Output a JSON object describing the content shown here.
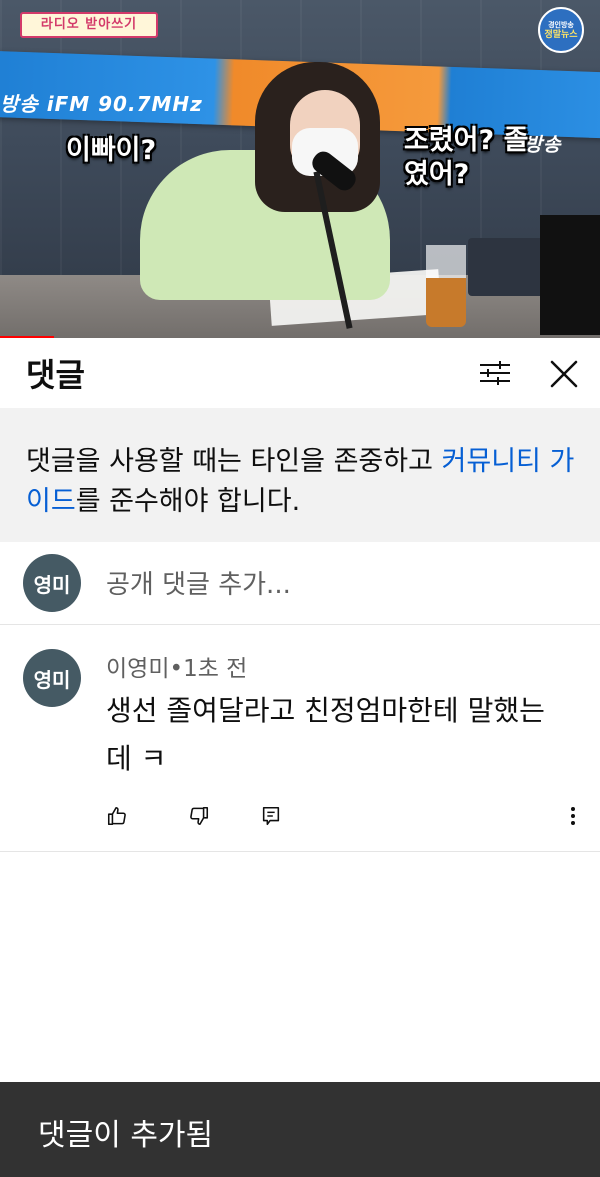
{
  "video": {
    "program_logo": "라디오 받아쓰기",
    "station_badge_top": "경인방송",
    "station_badge_bottom": "정말뉴스",
    "banner_left": "방송 iFM 90.7MHz",
    "banner_right": "인방송",
    "caption_left": "이빠이?",
    "caption_right": "조렸어? 졸였어?",
    "progress_fraction": 0.09,
    "accent_color": "#ff0000"
  },
  "panel": {
    "title": "댓글",
    "filter_icon": "sort-filter-icon",
    "close_icon": "close-icon"
  },
  "guideline": {
    "text_before": "댓글을 사용할 때는 타인을 존중하고 ",
    "link_text": "커뮤니티 가이드",
    "text_after": "를 준수해야 합니다.",
    "link_color": "#065fd4"
  },
  "add_comment": {
    "avatar_text": "영미",
    "placeholder": "공개 댓글 추가..."
  },
  "comments": [
    {
      "avatar_text": "영미",
      "author": "이영미",
      "separator": "•",
      "time": "1초 전",
      "text": "생선 졸여달라고 친정엄마한테 말했는데  ㅋ",
      "actions": [
        "thumbs-up-icon",
        "thumbs-down-icon",
        "reply-icon",
        "more-vert-icon"
      ]
    }
  ],
  "toast": {
    "text": "댓글이 추가됨"
  }
}
